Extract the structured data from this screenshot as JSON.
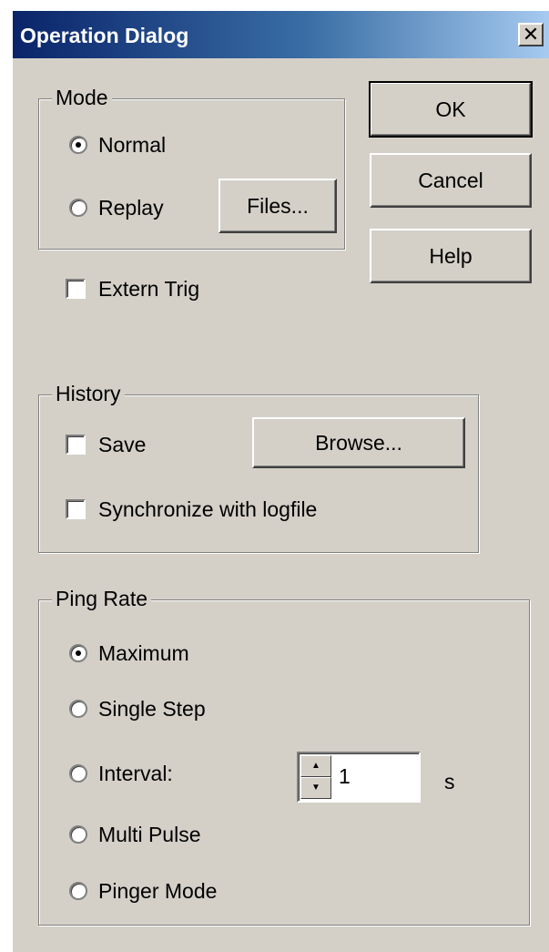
{
  "window": {
    "title": "Operation Dialog",
    "close_label": "✕"
  },
  "buttons": {
    "ok": "OK",
    "cancel": "Cancel",
    "help": "Help"
  },
  "mode": {
    "legend": "Mode",
    "normal": "Normal",
    "replay": "Replay",
    "files": "Files...",
    "selected": "Normal"
  },
  "extern_trig": {
    "label": "Extern Trig",
    "checked": false
  },
  "history": {
    "legend": "History",
    "save": "Save",
    "browse": "Browse...",
    "sync": "Synchronize with logfile"
  },
  "ping_rate": {
    "legend": "Ping Rate",
    "options": [
      "Maximum",
      "Single Step",
      "Interval:",
      "Multi Pulse",
      "Pinger Mode"
    ],
    "selected": "Maximum",
    "interval_value": "1",
    "interval_unit": "s",
    "spin_up": "▲",
    "spin_down": "▼"
  }
}
